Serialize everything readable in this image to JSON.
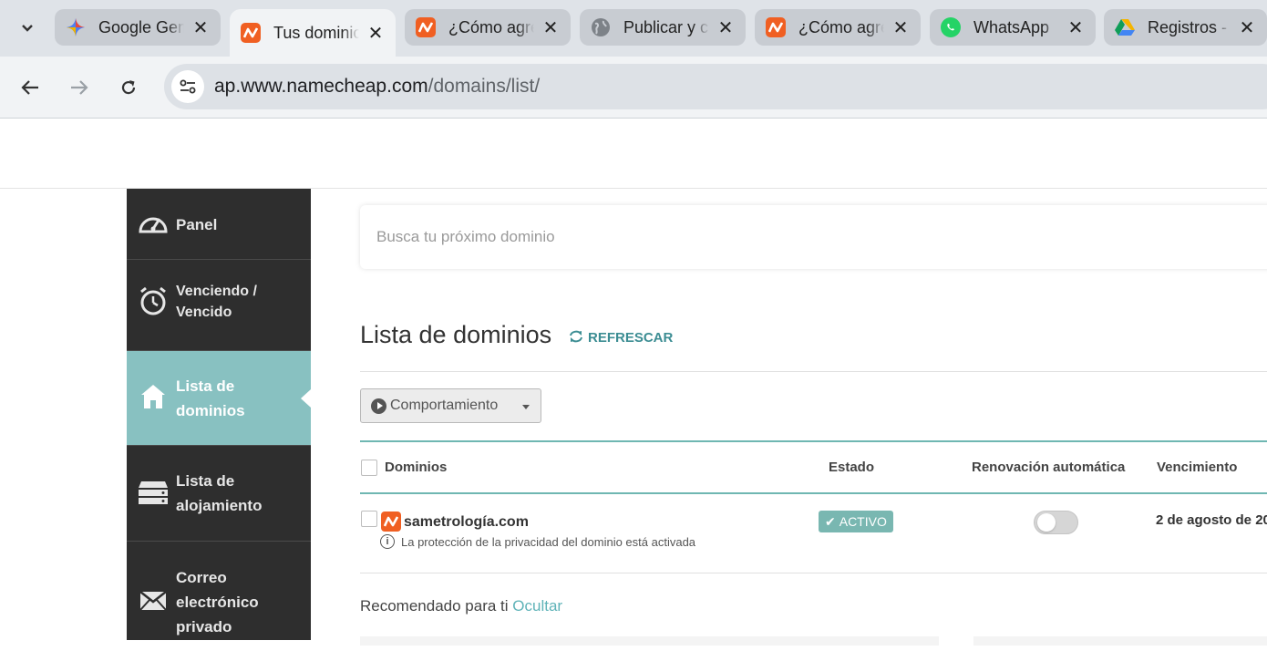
{
  "browser": {
    "tabs": [
      {
        "title": "Google Gemini",
        "icon": "gemini-icon"
      },
      {
        "title": "Tus dominios",
        "icon": "namecheap-icon",
        "active": true
      },
      {
        "title": "¿Cómo agregar",
        "icon": "namecheap-icon"
      },
      {
        "title": "Publicar y compartir",
        "icon": "globe-icon"
      },
      {
        "title": "¿Cómo agregar",
        "icon": "namecheap-icon"
      },
      {
        "title": "WhatsApp",
        "icon": "whatsapp-icon"
      },
      {
        "title": "Registros -",
        "icon": "google-drive-icon"
      }
    ],
    "url_host": "ap.www.namecheap.com",
    "url_path": "/domains/list/"
  },
  "sidebar": {
    "items": [
      {
        "label": "Panel",
        "icon": "dashboard-gauge-icon"
      },
      {
        "label": "Venciendo / Vencido",
        "icon": "stopwatch-icon"
      },
      {
        "label": "Lista de dominios",
        "icon": "home-icon",
        "active": true
      },
      {
        "label": "Lista de alojamiento",
        "icon": "server-icon"
      },
      {
        "label": "Correo electrónico privado",
        "icon": "envelope-icon"
      }
    ]
  },
  "search": {
    "placeholder": "Busca tu próximo dominio"
  },
  "main": {
    "title": "Lista de dominios",
    "refresh_label": "REFRESCAR",
    "behavior_label": "Comportamiento",
    "columns": {
      "domains": "Dominios",
      "status": "Estado",
      "auto_renew": "Renovación automática",
      "expiry": "Vencimiento"
    },
    "rows": [
      {
        "domain": "sametrología.com",
        "privacy_note": "La protección de la privacidad del dominio está activada",
        "status": "ACTIVO",
        "auto_renew": false,
        "expiry": "2 de agosto de 20"
      }
    ],
    "recommended_label": "Recomendado para ti",
    "hide_label": "Ocultar"
  },
  "colors": {
    "brand_orange": "#f05f22",
    "teal_accent": "#88c1c1",
    "sidebar_bg": "#2e2e2e",
    "active_badge": "#79b7b1"
  }
}
